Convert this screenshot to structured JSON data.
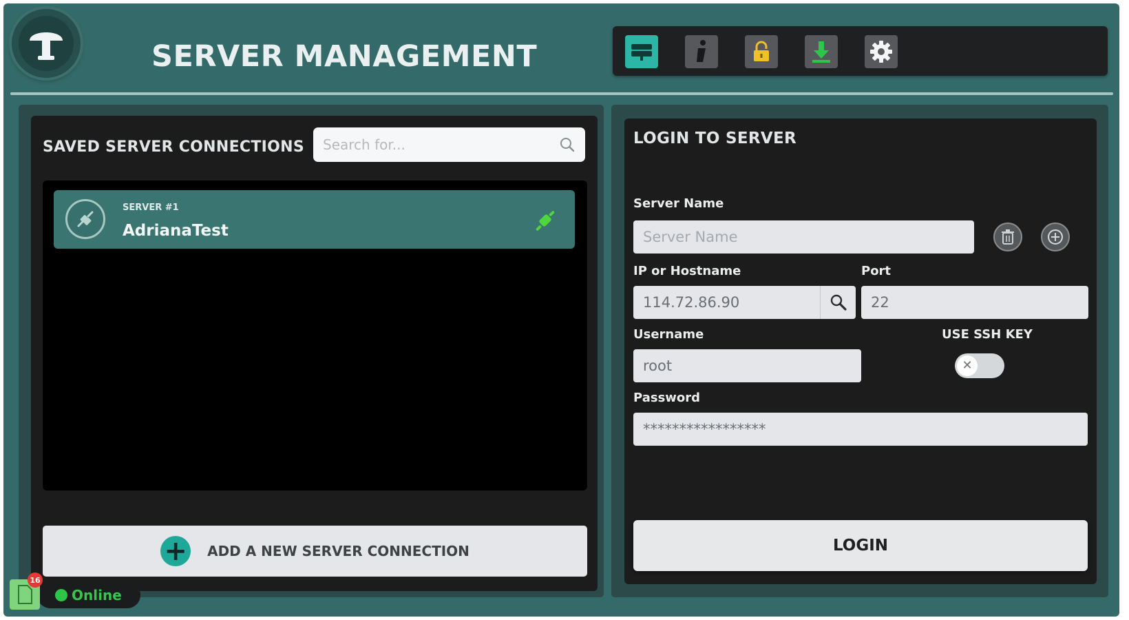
{
  "header": {
    "title": "SERVER MANAGEMENT",
    "toolbar": [
      {
        "icon": "server-icon",
        "active": true
      },
      {
        "icon": "info-icon",
        "active": false
      },
      {
        "icon": "lock-icon",
        "active": false
      },
      {
        "icon": "download-icon",
        "active": false
      },
      {
        "icon": "gear-icon",
        "active": false
      }
    ]
  },
  "saved": {
    "title": "SAVED SERVER CONNECTIONS",
    "search_placeholder": "Search for...",
    "servers": [
      {
        "number_label": "SERVER #1",
        "name": "AdrianaTest"
      }
    ],
    "add_label": "ADD A NEW SERVER CONNECTION"
  },
  "login": {
    "title": "LOGIN TO SERVER",
    "server_name_label": "Server Name",
    "server_name_placeholder": "Server Name",
    "ip_label": "IP or Hostname",
    "ip_value": "114.72.86.90",
    "port_label": "Port",
    "port_value": "22",
    "username_label": "Username",
    "username_value": "root",
    "ssh_label": "USE SSH KEY",
    "ssh_enabled": false,
    "password_label": "Password",
    "password_value": "*****************",
    "login_label": "LOGIN"
  },
  "status": {
    "text": "Online",
    "notification_count": "16"
  },
  "colors": {
    "background": "#346b6a",
    "accent": "#2bb6a6",
    "card": "#1c1c1d",
    "online": "#2ec44a"
  }
}
